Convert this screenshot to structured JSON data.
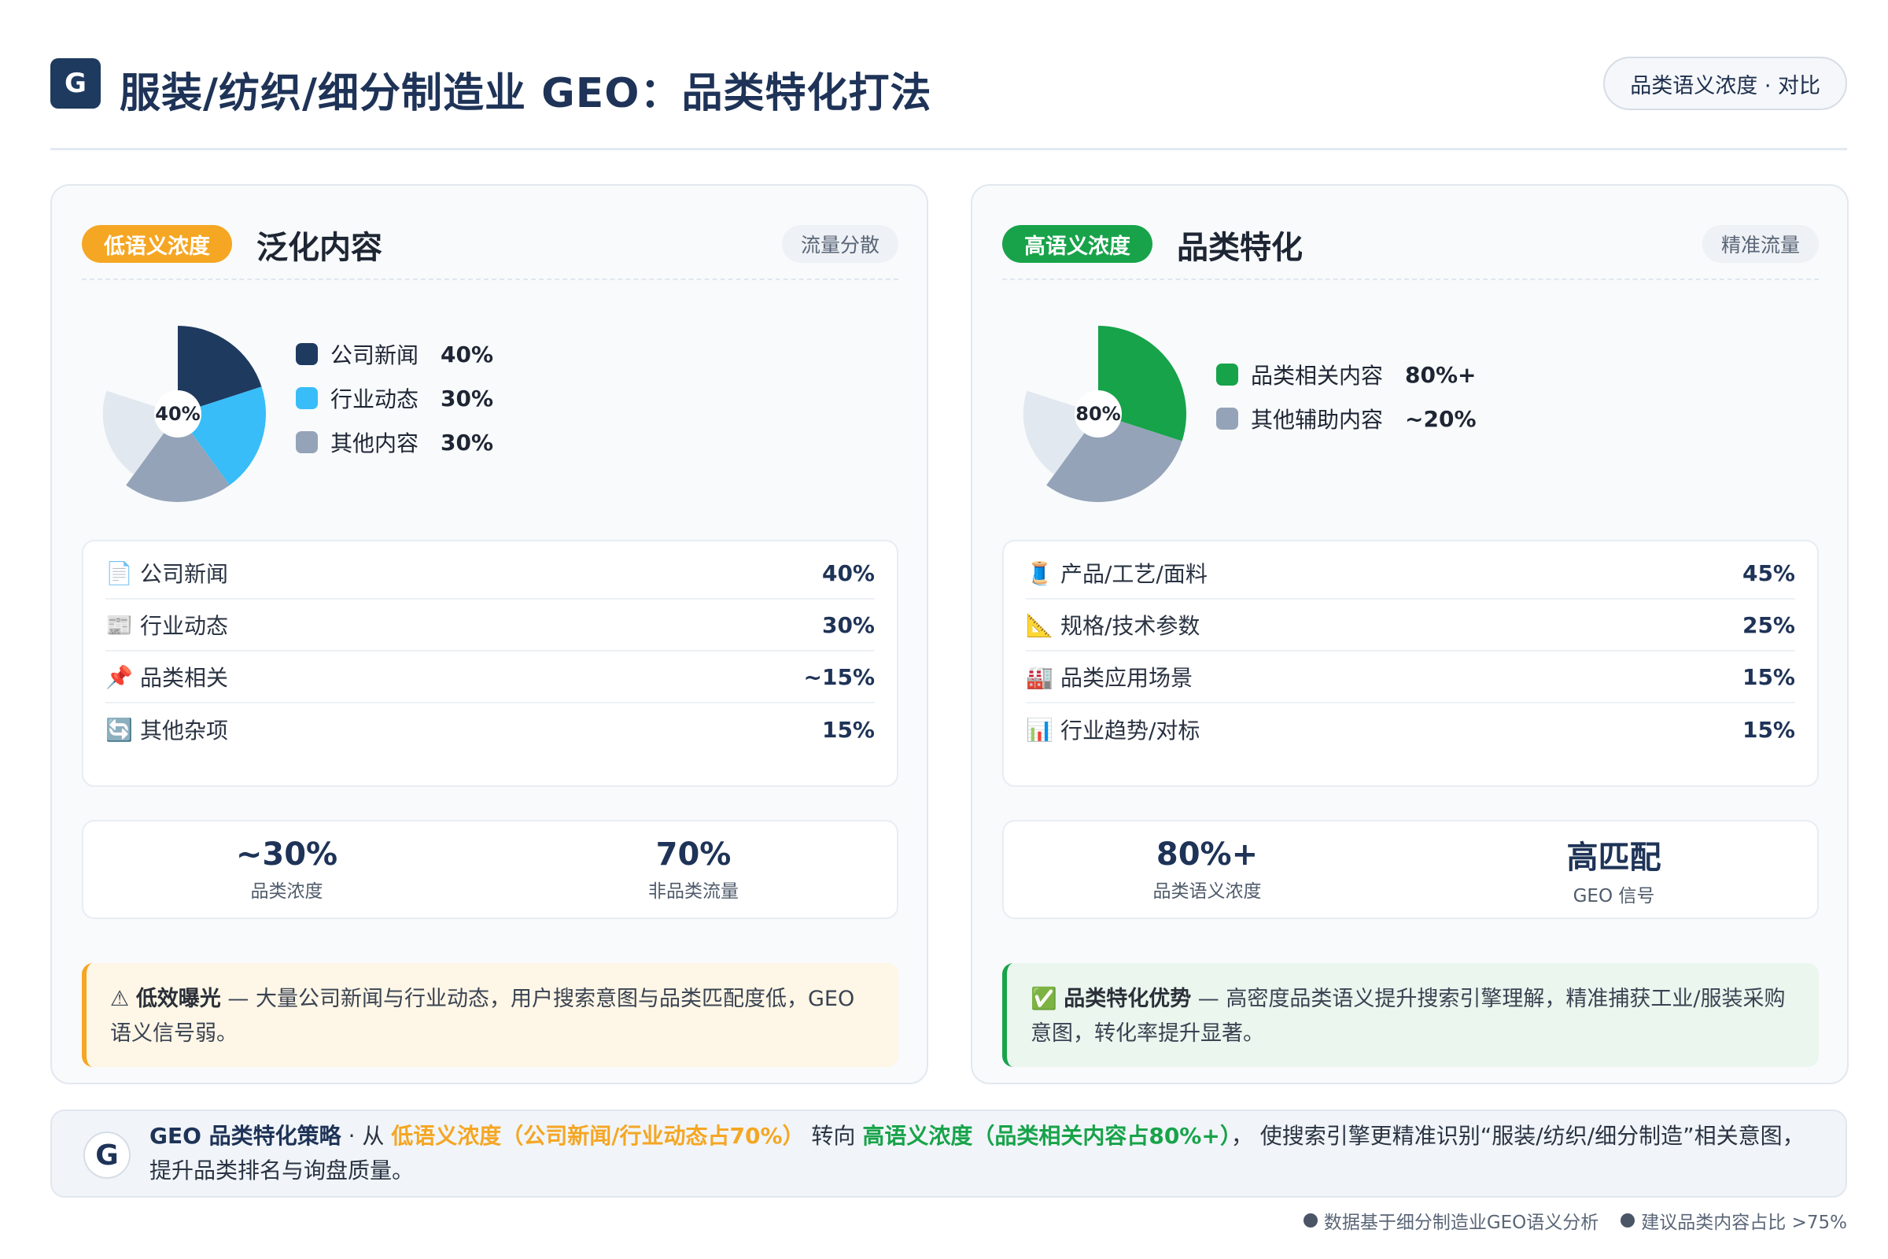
{
  "header": {
    "logo": "G",
    "title": "服装/纺织/细分制造业 GEO：品类特化打法",
    "pill": "品类语义浓度 · 对比"
  },
  "colors": {
    "navy": "#1e3a5f",
    "sky": "#38bdf8",
    "slate": "#94a3b8",
    "light": "#e2e8f0",
    "green": "#16a34a",
    "orange": "#f5a623"
  },
  "left": {
    "tag": "低语义浓度",
    "title": "泛化内容",
    "side": "流量分散",
    "list": [
      {
        "icon": "📄",
        "label": "公司新闻",
        "value": "40%"
      },
      {
        "icon": "📰",
        "label": "行业动态",
        "value": "30%"
      },
      {
        "icon": "📌",
        "label": "品类相关",
        "value": "~15%"
      },
      {
        "icon": "🔄",
        "label": "其他杂项",
        "value": "15%"
      }
    ],
    "stats": [
      {
        "value": "~30%",
        "label": "品类浓度"
      },
      {
        "value": "70%",
        "label": "非品类流量"
      }
    ],
    "note": {
      "icon": "⚠",
      "head": "低效曝光",
      "text": " — 大量公司新闻与行业动态，用户搜索意图与品类匹配度低，GEO 语义信号弱。"
    }
  },
  "right": {
    "tag": "高语义浓度",
    "title": "品类特化",
    "side": "精准流量",
    "list": [
      {
        "icon": "🧵",
        "label": "产品/工艺/面料",
        "value": "45%"
      },
      {
        "icon": "📐",
        "label": "规格/技术参数",
        "value": "25%"
      },
      {
        "icon": "🏭",
        "label": "品类应用场景",
        "value": "15%"
      },
      {
        "icon": "📊",
        "label": "行业趋势/对标",
        "value": "15%"
      }
    ],
    "stats": [
      {
        "value": "80%+",
        "label": "品类语义浓度"
      },
      {
        "value": "高匹配",
        "label": "GEO 信号"
      }
    ],
    "note": {
      "icon": "✅",
      "head": "品类特化优势",
      "text": " — 高密度品类语义提升搜索引擎理解，精准捕获工业/服装采购意图，转化率提升显著。"
    }
  },
  "chart_data": [
    {
      "type": "pie",
      "center_label": "40%",
      "legend": [
        {
          "label": "公司新闻",
          "value_label": "40%"
        },
        {
          "label": "行业动态",
          "value_label": "30%"
        },
        {
          "label": "其他内容",
          "value_label": "30%"
        }
      ],
      "slices": [
        {
          "value": 20,
          "color": "#1e3a5f",
          "r": 1.0
        },
        {
          "value": 20,
          "color": "#38bdf8",
          "r": 1.0
        },
        {
          "value": 20,
          "color": "#94a3b8",
          "r": 1.0
        },
        {
          "value": 20,
          "color": "#e2e8f0",
          "r": 0.85
        }
      ]
    },
    {
      "type": "pie",
      "center_label": "80%",
      "legend": [
        {
          "label": "品类相关内容",
          "value_label": "80%+"
        },
        {
          "label": "其他辅助内容",
          "value_label": "~20%"
        }
      ],
      "slices": [
        {
          "value": 30,
          "color": "#16a34a",
          "r": 1.0
        },
        {
          "value": 30,
          "color": "#94a3b8",
          "r": 1.0
        },
        {
          "value": 20,
          "color": "#e2e8f0",
          "r": 0.85
        }
      ]
    }
  ],
  "banner": {
    "logo": "G",
    "strong": "GEO 品类特化策略",
    "sep": " · 从 ",
    "orange": "低语义浓度（公司新闻/行业动态占70%）",
    "mid": " 转向 ",
    "green": "高语义浓度（品类相关内容占80%+）",
    "tail": "， 使搜索引擎更精准识别“服装/纺织/细分制造”相关意图，提升品类排名与询盘质量。"
  },
  "footer": {
    "note1": "数据基于细分制造业GEO语义分析",
    "note2": "建议品类内容占比 >75%"
  }
}
